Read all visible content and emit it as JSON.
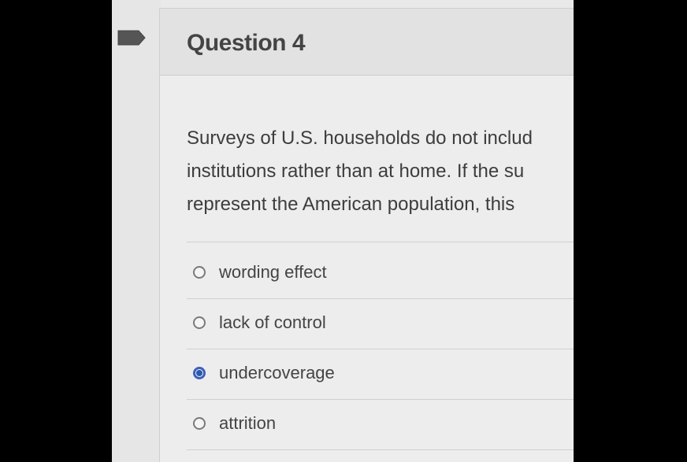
{
  "question": {
    "title": "Question 4",
    "text_lines": [
      "Surveys of U.S. households do not includ",
      "institutions rather than at home. If the su",
      "represent the American population, this"
    ]
  },
  "options": [
    {
      "label": "wording effect",
      "selected": false
    },
    {
      "label": "lack of control",
      "selected": false
    },
    {
      "label": "undercoverage",
      "selected": true
    },
    {
      "label": "attrition",
      "selected": false
    }
  ],
  "colors": {
    "selected_radio": "#2f56b0",
    "flag": "#555555"
  },
  "icons": {
    "flag": "flag-icon"
  }
}
